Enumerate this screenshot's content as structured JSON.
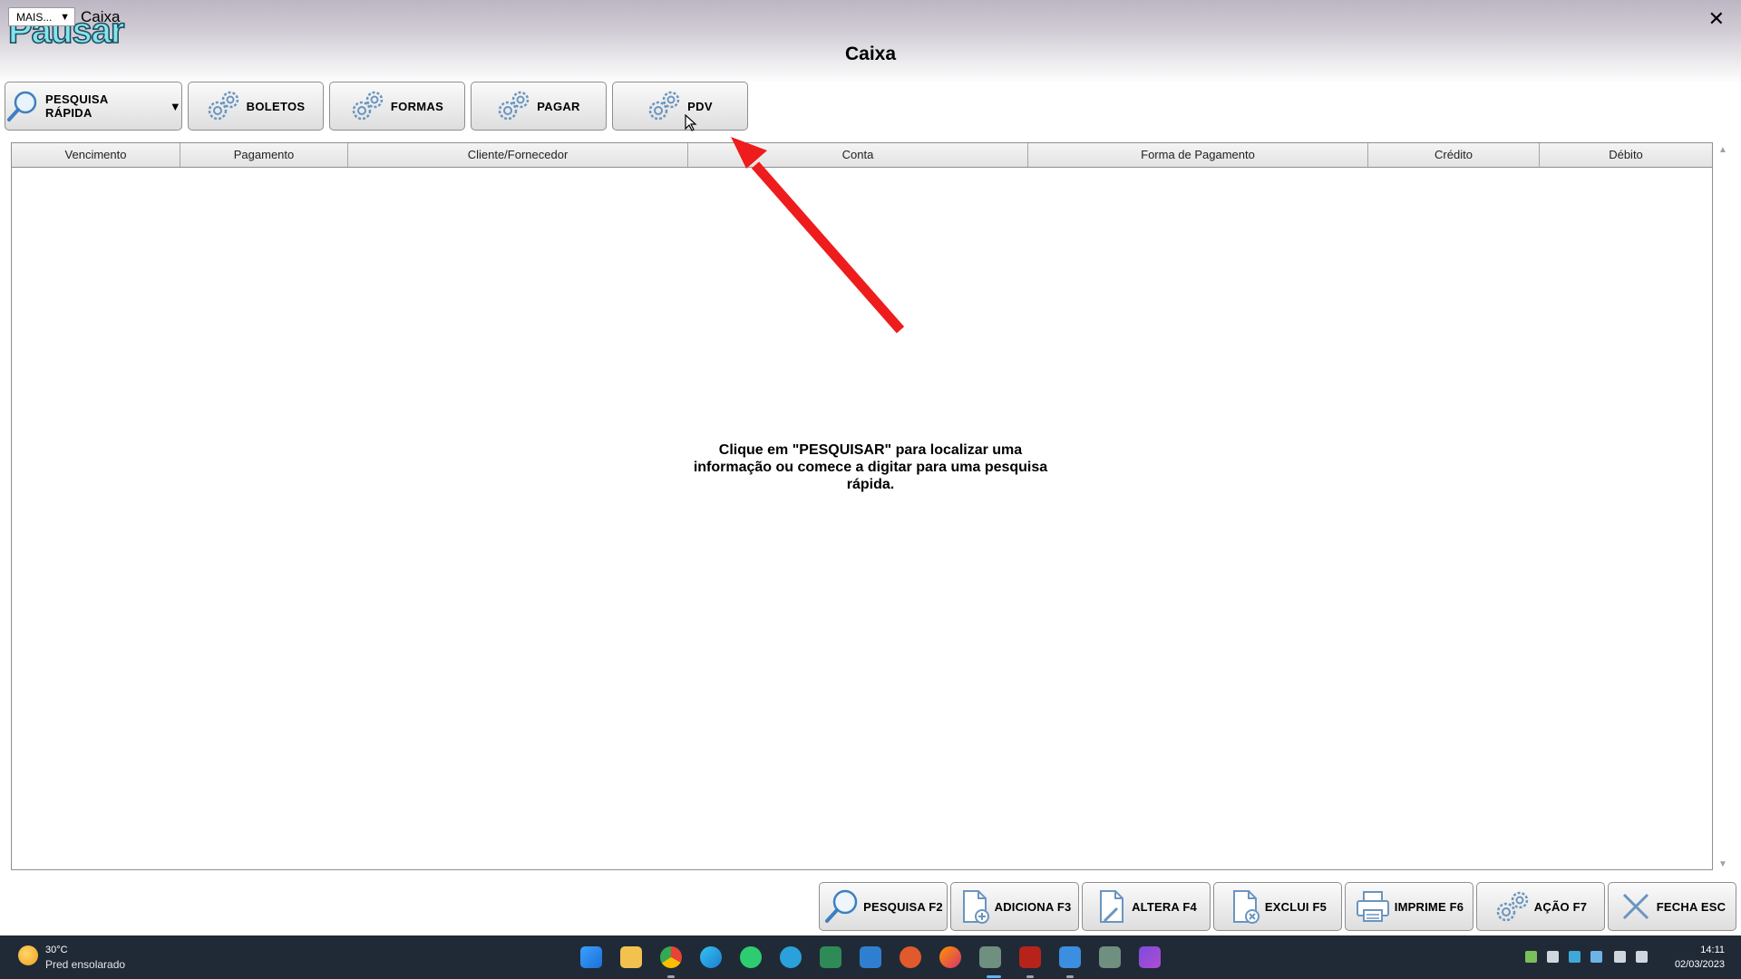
{
  "window": {
    "mais_label": "MAIS...",
    "mais_arrow": "▼",
    "title": "Caixa",
    "logo_text": "Pausar",
    "close_glyph": "✕",
    "page_title": "Caixa"
  },
  "toolbar": {
    "quick_search_label": "PESQUISA RÁPIDA",
    "quick_search_arrow": "▼",
    "boletos_label": "BOLETOS",
    "formas_label": "FORMAS",
    "pagar_label": "PAGAR",
    "pdv_label": "PDV"
  },
  "grid": {
    "columns": [
      "Vencimento",
      "Pagamento",
      "Cliente/Fornecedor",
      "Conta",
      "Forma de Pagamento",
      "Crédito",
      "Débito"
    ],
    "empty_message": "Clique em \"PESQUISAR\" para localizar uma informação ou comece a digitar para uma pesquisa rápida."
  },
  "actions": {
    "pesquisa": "PESQUISA F2",
    "adiciona": "ADICIONA F3",
    "altera": "ALTERA F4",
    "exclui": "EXCLUI F5",
    "imprime": "IMPRIME F6",
    "acao": "AÇÃO F7",
    "fecha": "FECHA ESC"
  },
  "annotation": {
    "arrow_color": "#ee1c1c"
  },
  "taskbar": {
    "weather_temp": "30°C",
    "weather_desc": "Pred ensolarado",
    "time": "14:11",
    "date": "02/03/2023",
    "pinned_icons": [
      "windows-start-icon",
      "file-explorer-icon",
      "chrome-icon",
      "edge-icon",
      "whatsapp-icon",
      "telegram-icon",
      "spreadsheet-icon",
      "remote-desktop-icon",
      "app-icon",
      "firefox-icon",
      "pausar-app-icon",
      "filezilla-icon",
      "notepad-icon",
      "pausar-app-icon-2",
      "video-editor-icon"
    ]
  }
}
